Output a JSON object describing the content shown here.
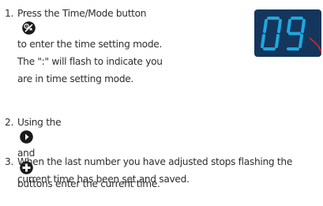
{
  "steps": [
    {
      "number": "1.",
      "line1_before": "Press the Time/Mode button",
      "icon_after_line1": "time-mode-icon",
      "lines": [
        "to enter the time setting mode.",
        "The \":\" will flash to indicate you",
        "are in time setting mode."
      ]
    },
    {
      "number": "2.",
      "part1": "Using the",
      "icon1": "right-arrow-icon",
      "part2": "and",
      "icon2": "plus-icon",
      "part3": "buttons enter the current time."
    },
    {
      "number": "3.",
      "lines": [
        "When the last number you have adjusted stops flashing the",
        "current time has been set and saved."
      ]
    }
  ],
  "display": {
    "digits": "09",
    "colors": {
      "background": "#14365c",
      "segments": "#1fa8e0",
      "highlight": "#d9262b"
    }
  },
  "colors": {
    "text": "#2e2e2e",
    "icon": "#1a1a1a"
  }
}
